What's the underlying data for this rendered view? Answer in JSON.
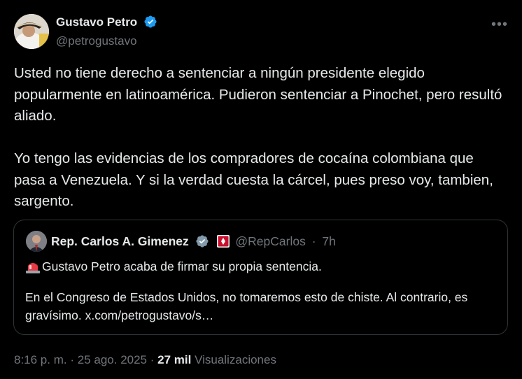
{
  "tweet": {
    "author_name": "Gustavo Petro",
    "author_handle": "@petrogustavo",
    "paragraphs": [
      "Usted no tiene derecho a sentenciar a ningún presidente elegido popularmente en latinoamérica. Pudieron sentenciar a Pinochet, pero resultó aliado.",
      "Yo tengo las evidencias de los compradores de cocaína colombiana que pasa a Venezuela. Y si la verdad cuesta la cárcel, pues preso voy, tambien, sargento."
    ],
    "time": "8:16 p. m.",
    "separator": "·",
    "date": "25 ago. 2025",
    "views_count": "27 mil",
    "views_label": "Visualizaciones",
    "more_icon": "more-dots-icon"
  },
  "quote": {
    "author_name": "Rep. Carlos A. Gimenez",
    "author_handle": "@RepCarlos",
    "separator": "·",
    "time_ago": "7h",
    "line1": "Gustavo Petro acaba de firmar su propia sentencia.",
    "line2": "En el Congreso de Estados Unidos, no tomaremos esto de chiste. Al contrario, es gravísimo. x.com/petrogustavo/s…"
  },
  "colors": {
    "background": "#000000",
    "text": "#e7e9ea",
    "muted": "#71767b",
    "verified": "#1d9bf0",
    "border": "#2f3336"
  }
}
